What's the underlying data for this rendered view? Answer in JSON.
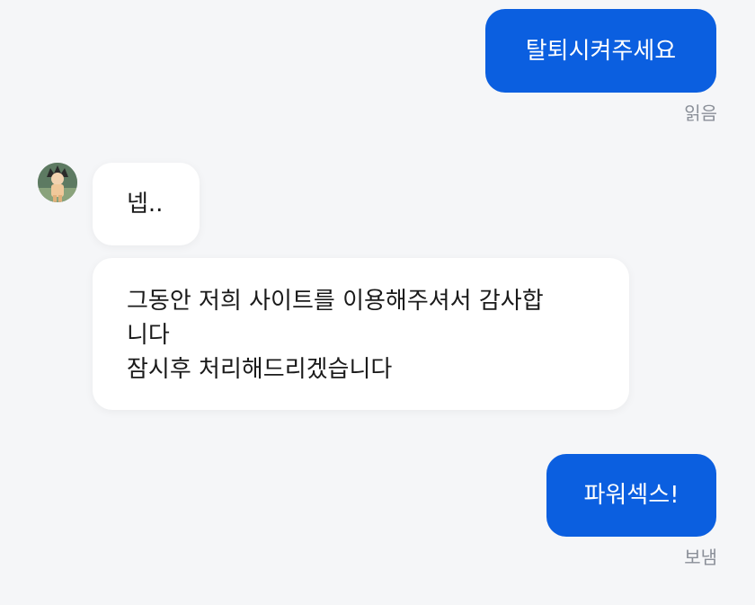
{
  "messages": {
    "out1": {
      "text": "탈퇴시켜주세요",
      "status": "읽음"
    },
    "in1": {
      "text": "넵.."
    },
    "in2": {
      "lines": [
        "그동안 저희 사이트를 이용해주셔서 감사합",
        "니다",
        "잠시후 처리해드리겠습니다"
      ]
    },
    "out2": {
      "text": "파워섹스!",
      "status": "보냄"
    }
  },
  "icons": {
    "avatar": "user-avatar-icon"
  },
  "colors": {
    "outgoing_bubble": "#0b5fe0",
    "incoming_bubble": "#ffffff",
    "background": "#f5f6f8",
    "status_text": "#8a8f98"
  }
}
